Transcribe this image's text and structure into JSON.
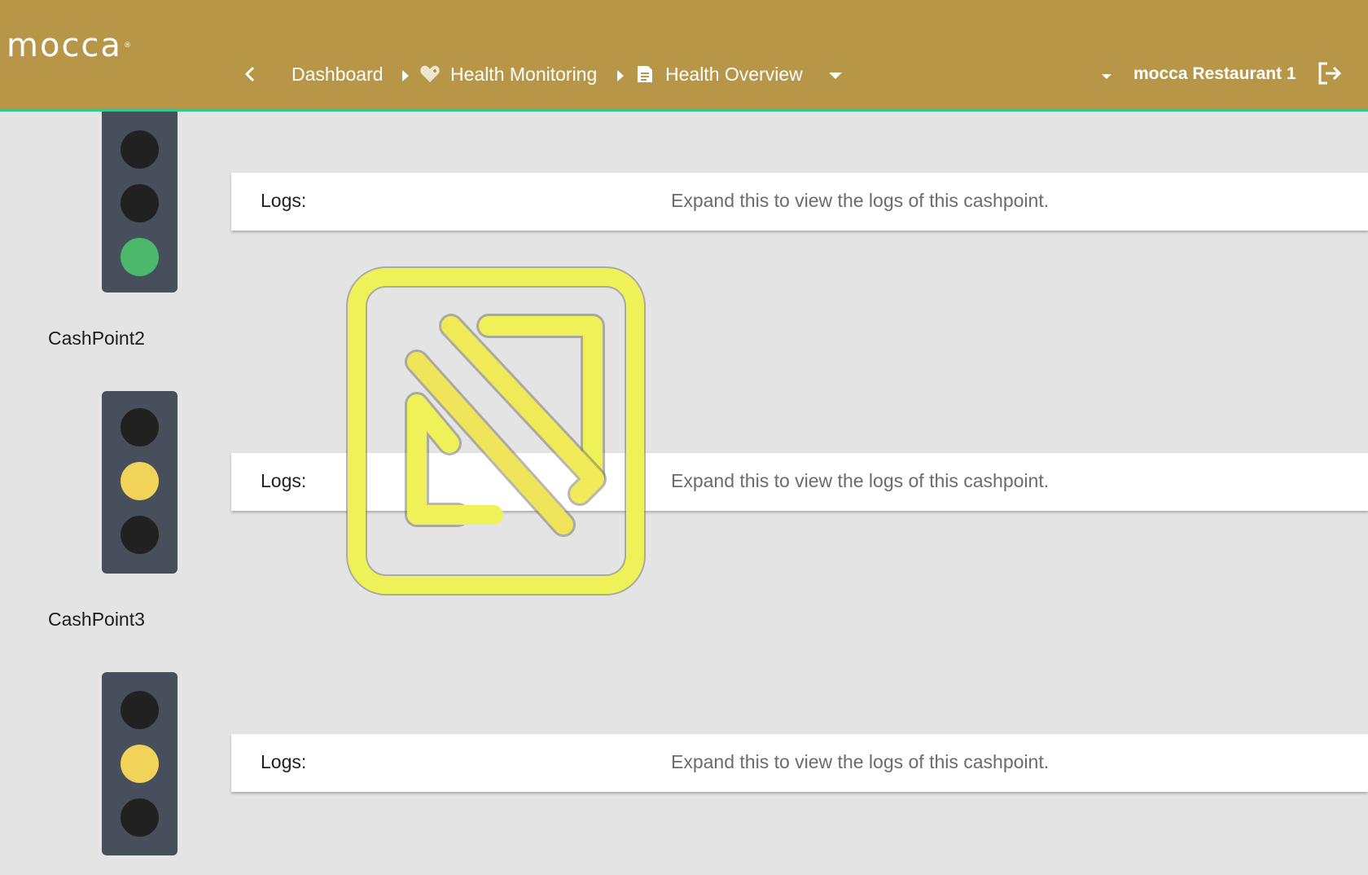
{
  "header": {
    "logo_text": "mocca",
    "logo_mark": "®",
    "breadcrumbs": [
      {
        "label": "Dashboard",
        "icon": ""
      },
      {
        "label": "Health Monitoring",
        "icon": "heart-icon"
      },
      {
        "label": "Health Overview",
        "icon": "document-icon"
      }
    ],
    "restaurant": "mocca Restaurant 1",
    "icons": [
      "back-chevron-icon",
      "dropdown-caret-icon",
      "logout-icon"
    ]
  },
  "colors": {
    "header_bg": "#b89648",
    "header_border": "#3ec48e",
    "traffic_light_bg": "#474f5d",
    "lamp_off": "#212121",
    "lamp_green": "#4bb86c",
    "lamp_yellow": "#f0d358",
    "watermark": "#eef258"
  },
  "cashpoints": [
    {
      "name": "",
      "status": "green",
      "logs_label": "Logs:",
      "logs_hint": "Expand this to view the logs of this cashpoint."
    },
    {
      "name": "CashPoint2",
      "status": "yellow",
      "logs_label": "Logs:",
      "logs_hint": "Expand this to view the logs of this cashpoint."
    },
    {
      "name": "CashPoint3",
      "status": "yellow",
      "logs_label": "Logs:",
      "logs_hint": "Expand this to view the logs of this cashpoint."
    }
  ]
}
